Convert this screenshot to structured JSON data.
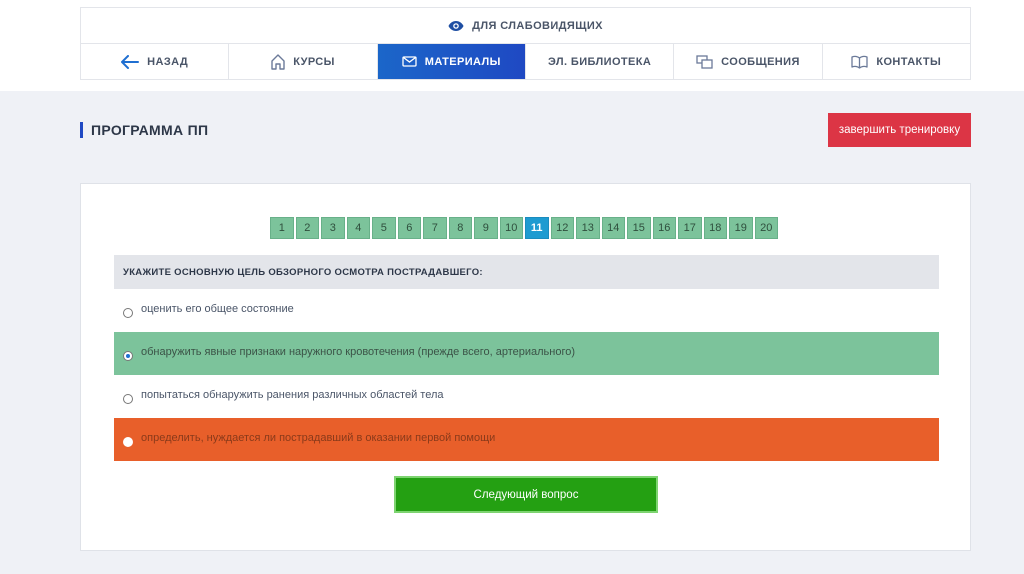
{
  "accessibility": {
    "label": "ДЛЯ СЛАБОВИДЯЩИХ",
    "icon": "eye-icon"
  },
  "nav": {
    "items": [
      {
        "label": "НАЗАД",
        "icon": "arrow-left-icon"
      },
      {
        "label": "КУРСЫ",
        "icon": "home-icon"
      },
      {
        "label": "МАТЕРИАЛЫ",
        "icon": "envelope-icon",
        "active": true
      },
      {
        "label": "ЭЛ. БИБЛИОТЕКА",
        "icon": ""
      },
      {
        "label": "СООБЩЕНИЯ",
        "icon": "messages-icon"
      },
      {
        "label": "КОНТАКТЫ",
        "icon": "book-icon"
      }
    ]
  },
  "page": {
    "title": "ПРОГРАММА ПП",
    "finish_label": "завершить тренировку"
  },
  "pager": {
    "pages": [
      "1",
      "2",
      "3",
      "4",
      "5",
      "6",
      "7",
      "8",
      "9",
      "10",
      "11",
      "12",
      "13",
      "14",
      "15",
      "16",
      "17",
      "18",
      "19",
      "20"
    ],
    "current": "11"
  },
  "quiz": {
    "question": "УКАЖИТЕ ОСНОВНУЮ ЦЕЛЬ ОБЗОРНОГО ОСМОТРА ПОСТРАДАВШЕГО:",
    "answers": [
      {
        "text": "оценить его общее состояние",
        "state": "neutral",
        "selected": false
      },
      {
        "text": "обнаружить явные признаки наружного кровотечения (прежде всего, артериального)",
        "state": "correct",
        "selected": true
      },
      {
        "text": "попытаться обнаружить ранения различных областей тела",
        "state": "neutral",
        "selected": false
      },
      {
        "text": "определить, нуждается ли пострадавший в оказании первой помощи",
        "state": "wrong",
        "selected": false
      }
    ],
    "next_label": "Следующий вопрос"
  },
  "colors": {
    "active_nav": "#1f49c3",
    "correct": "#7cc39b",
    "wrong": "#e85f2a",
    "finish": "#dc3545",
    "next": "#24a012",
    "current_page": "#1e9bd1"
  }
}
